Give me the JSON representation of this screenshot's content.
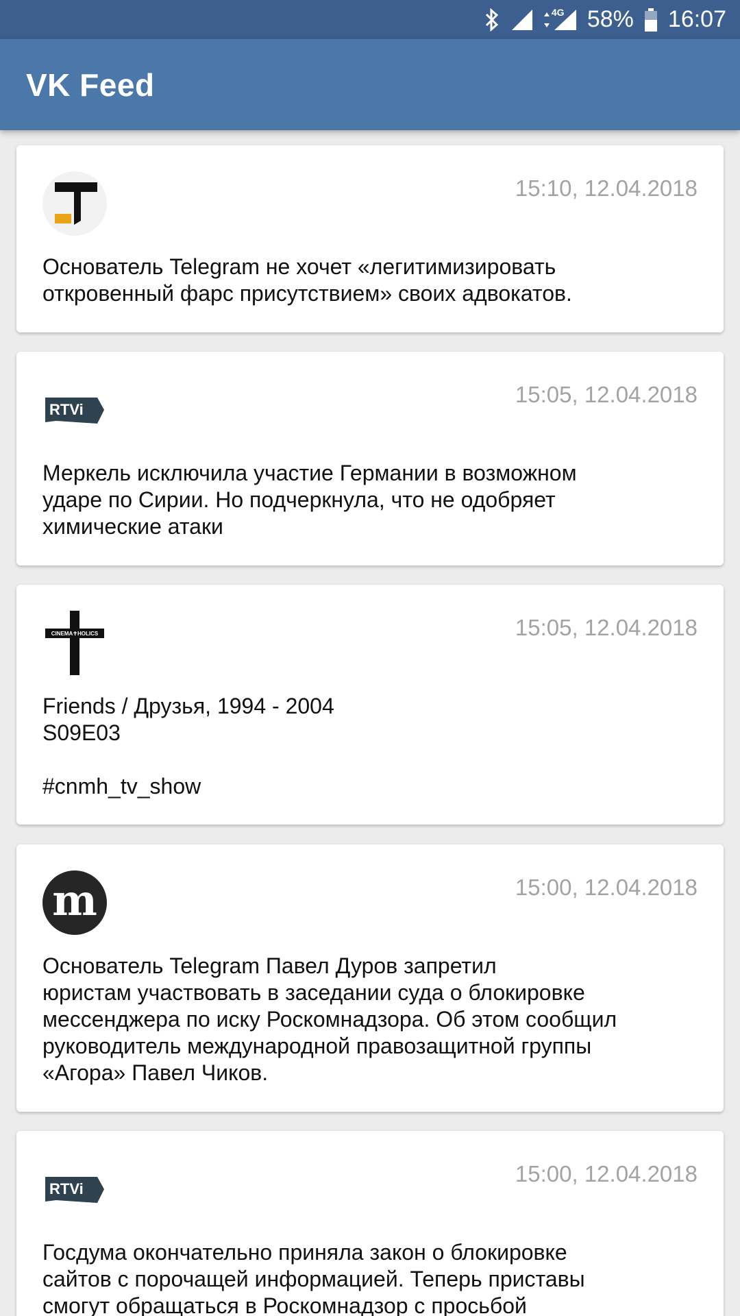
{
  "status_bar": {
    "network": "4G",
    "battery": "58%",
    "time": "16:07"
  },
  "app_bar": {
    "title": "VK Feed"
  },
  "colors": {
    "status_bar": "#3c5f8f",
    "app_bar": "#4b77a9",
    "background": "#ececec",
    "timestamp": "#a3a3a3"
  },
  "posts": [
    {
      "source_icon": "tj-logo-icon",
      "time": "15:10, 12.04.2018",
      "text": "Основатель Telegram не хочет «легитимизировать\nоткровенный фарс присутствием» своих адвокатов."
    },
    {
      "source_icon": "rtvi-logo-icon",
      "avatar_label": "RTVi",
      "time": "15:05, 12.04.2018",
      "text": "Меркель исключила участие Германии в возможном\nударе по Сирии. Но подчеркнула, что не одобряет\nхимические атаки"
    },
    {
      "source_icon": "cinemaholics-logo-icon",
      "avatar_label": "CINEMA✝HOLICS",
      "time": "15:05, 12.04.2018",
      "text": "Friends / Друзья, 1994 - 2004\nS09E03\n\n#cnmh_tv_show"
    },
    {
      "source_icon": "meduza-logo-icon",
      "avatar_label": "m",
      "time": "15:00, 12.04.2018",
      "text": "Основатель Telegram Павел Дуров запретил\nюристам участвовать в заседании суда о блокировке\nмессенджера по иску Роскомнадзора. Об этом сообщил\nруководитель международной правозащитной группы\n«Агора» Павел Чиков."
    },
    {
      "source_icon": "rtvi-logo-icon",
      "avatar_label": "RTVi",
      "time": "15:00, 12.04.2018",
      "text": "Госдума окончательно приняла закон о блокировке\nсайтов с порочащей информацией. Теперь приставы\nсмогут обращаться в Роскомнадзор с просьбой"
    }
  ]
}
